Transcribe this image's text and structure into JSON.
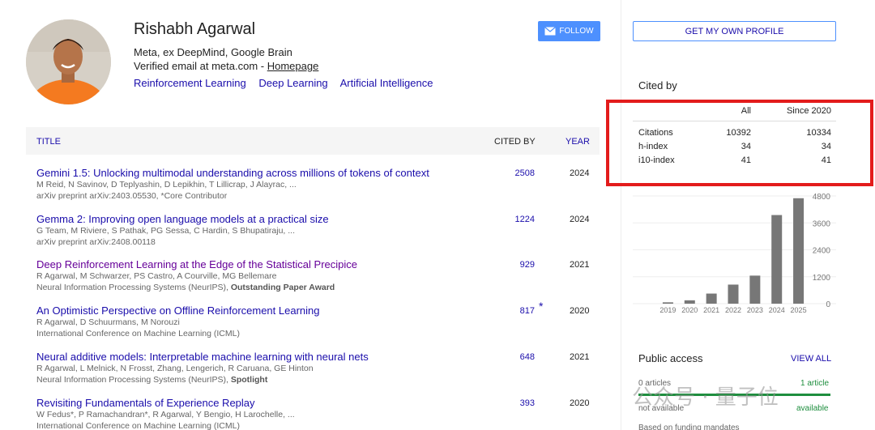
{
  "profile": {
    "name": "Rishabh Agarwal",
    "affiliation": "Meta, ex DeepMind, Google Brain",
    "verified_text": "Verified email at meta.com - ",
    "homepage_label": "Homepage",
    "interests": [
      "Reinforcement Learning",
      "Deep Learning",
      "Artificial Intelligence"
    ],
    "follow_label": "FOLLOW",
    "follow_icon": "mail-icon"
  },
  "table": {
    "header": {
      "title": "TITLE",
      "cited_by": "CITED BY",
      "year": "YEAR"
    },
    "rows": [
      {
        "title": "Gemini 1.5: Unlocking multimodal understanding across millions of tokens of context",
        "authors": "M Reid, N Savinov, D Teplyashin, D Lepikhin, T Lillicrap, J Alayrac, ...",
        "venue": "arXiv preprint arXiv:2403.05530, *Core Contributor",
        "award": "",
        "cited": "2508",
        "year": "2024"
      },
      {
        "title": "Gemma 2: Improving open language models at a practical size",
        "authors": "G Team, M Riviere, S Pathak, PG Sessa, C Hardin, S Bhupatiraju, ...",
        "venue": "arXiv preprint arXiv:2408.00118",
        "award": "",
        "cited": "1224",
        "year": "2024"
      },
      {
        "title": "Deep Reinforcement Learning at the Edge of the Statistical Precipice",
        "authors": "R Agarwal, M Schwarzer, PS Castro, A Courville, MG Bellemare",
        "venue": "Neural Information Processing Systems (NeurIPS), ",
        "award": "Outstanding Paper Award",
        "cited": "929",
        "year": "2021"
      },
      {
        "title": "An Optimistic Perspective on Offline Reinforcement Learning",
        "authors": "R Agarwal, D Schuurmans, M Norouzi",
        "venue": "International Conference on Machine Learning (ICML)",
        "award": "",
        "cited": "817",
        "star": "*",
        "year": "2020"
      },
      {
        "title": "Neural additive models: Interpretable machine learning with neural nets",
        "authors": "R Agarwal, L Melnick, N Frosst, Zhang, Lengerich, R Caruana, GE Hinton",
        "venue": "Neural Information Processing Systems (NeurIPS), ",
        "award": "Spotlight",
        "cited": "648",
        "year": "2021"
      },
      {
        "title": "Revisiting Fundamentals of Experience Replay",
        "authors": "W Fedus*, P Ramachandran*, R Agarwal, Y Bengio, H Larochelle, ...",
        "venue": "International Conference on Machine Learning (ICML)",
        "award": "",
        "cited": "393",
        "year": "2020"
      }
    ]
  },
  "sidebar": {
    "own_profile_label": "GET MY OWN PROFILE",
    "cited_by_title": "Cited by",
    "cites_header": {
      "all": "All",
      "since": "Since 2020"
    },
    "cites_rows": [
      {
        "label": "Citations",
        "all": "10392",
        "since": "10334"
      },
      {
        "label": "h-index",
        "all": "34",
        "since": "34"
      },
      {
        "label": "i10-index",
        "all": "41",
        "since": "41"
      }
    ],
    "public_access_title": "Public access",
    "view_all_label": "VIEW ALL",
    "pa_left_count": "0 articles",
    "pa_left_status": "not available",
    "pa_right_count": "1 article",
    "pa_right_status": "available",
    "mandates_text": "Based on funding mandates"
  },
  "chart_data": {
    "type": "bar",
    "categories": [
      "2019",
      "2020",
      "2021",
      "2022",
      "2023",
      "2024",
      "2025"
    ],
    "values": [
      60,
      150,
      450,
      850,
      1250,
      3950,
      4700
    ],
    "yticks": [
      "4800",
      "3600",
      "2400",
      "1200",
      "0"
    ],
    "ylim": [
      0,
      4800
    ]
  },
  "watermark": "公众号 · 量子位",
  "colors": {
    "link": "#1a0dab",
    "visited": "#660099",
    "accent": "#4d90fe",
    "highlight": "#e31b1b",
    "bar": "#777777"
  }
}
